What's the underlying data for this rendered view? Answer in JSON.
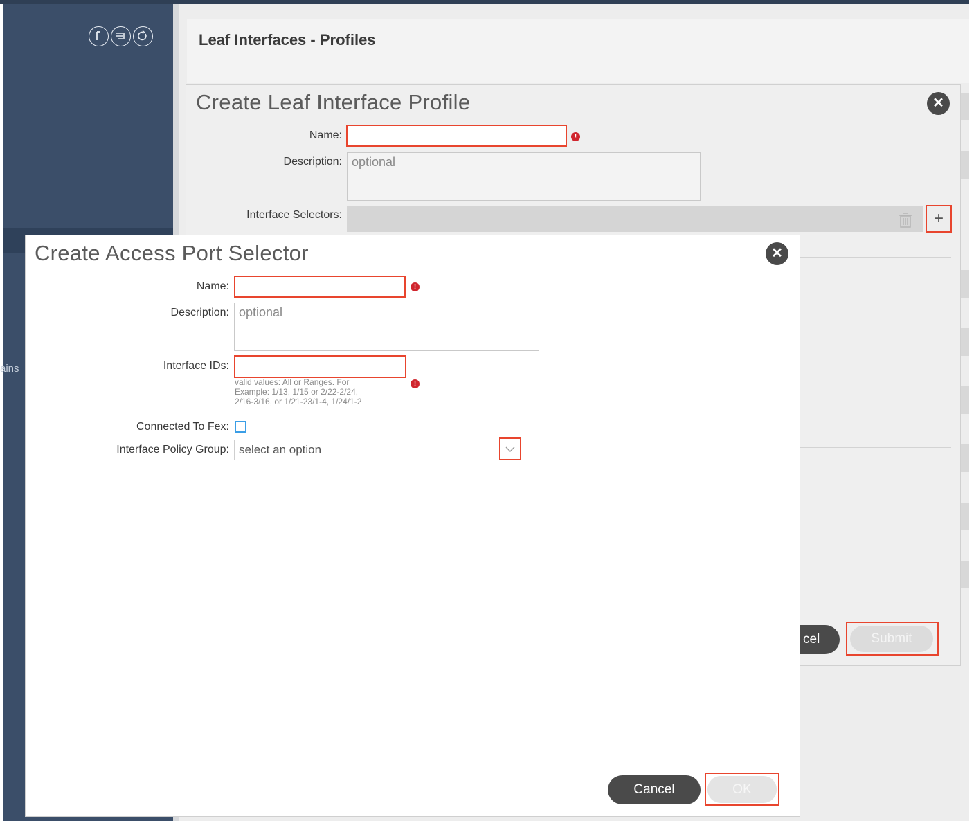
{
  "page": {
    "title": "Leaf Interfaces - Profiles"
  },
  "sidebar": {
    "icons": [
      "info-circle-icon",
      "list-circle-icon",
      "refresh-circle-icon"
    ],
    "fragment_text": "ains"
  },
  "leaf_profile_dialog": {
    "title": "Create Leaf Interface Profile",
    "name_label": "Name:",
    "name_value": "",
    "description_label": "Description:",
    "description_placeholder": "optional",
    "interface_selectors_label": "Interface Selectors:",
    "cancel_label": "Cancel",
    "cancel_visible_text": "cel",
    "submit_label": "Submit"
  },
  "access_port_dialog": {
    "title": "Create Access Port Selector",
    "name_label": "Name:",
    "name_value": "",
    "description_label": "Description:",
    "description_placeholder": "optional",
    "interface_ids_label": "Interface IDs:",
    "interface_ids_value": "",
    "interface_ids_hint": [
      "valid values: All or Ranges. For",
      "Example: 1/13, 1/15 or 2/22-2/24,",
      "2/16-3/16, or 1/21-23/1-4, 1/24/1-2"
    ],
    "connected_to_fex_label": "Connected To Fex:",
    "connected_to_fex_checked": false,
    "policy_group_label": "Interface Policy Group:",
    "policy_group_placeholder": "select an option",
    "cancel_label": "Cancel",
    "ok_label": "OK"
  },
  "colors": {
    "sidebar": "#3b4e69",
    "highlight": "#e8452e",
    "required": "#d0262e",
    "checkbox": "#3b9ee6"
  }
}
